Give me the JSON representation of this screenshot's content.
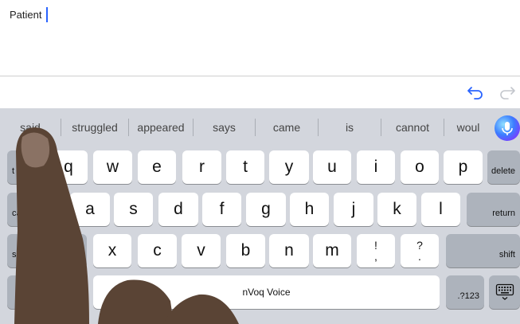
{
  "editor": {
    "text": "Patient"
  },
  "suggestions": [
    "said",
    "struggled",
    "appeared",
    "says",
    "came",
    "is",
    "cannot",
    "woul"
  ],
  "keyboard": {
    "row1": [
      "q",
      "w",
      "e",
      "r",
      "t",
      "y",
      "u",
      "i",
      "o",
      "p"
    ],
    "row2": [
      "a",
      "s",
      "d",
      "f",
      "g",
      "h",
      "j",
      "k",
      "l"
    ],
    "row3": [
      "x",
      "c",
      "v",
      "b",
      "n",
      "m"
    ],
    "punct1": {
      "top": "!",
      "bottom": ","
    },
    "punct2": {
      "top": "?",
      "bottom": "."
    },
    "tab_label": "t",
    "caps_label": "ca",
    "shift_left_label": "shift",
    "shift_right_label": "shift",
    "delete_label": "delete",
    "return_label": "return",
    "space_label": "nVoq Voice",
    "numbers_label": ".?123"
  },
  "colors": {
    "accent": "#2a64ff",
    "keyboard_bg": "#d3d6dd",
    "function_key": "#adb3bc"
  },
  "icons": {
    "undo": "undo-arrow-icon",
    "redo": "redo-arrow-icon",
    "mic": "microphone-icon",
    "globe": "globe-icon",
    "hide_keyboard": "keyboard-dismiss-icon"
  }
}
